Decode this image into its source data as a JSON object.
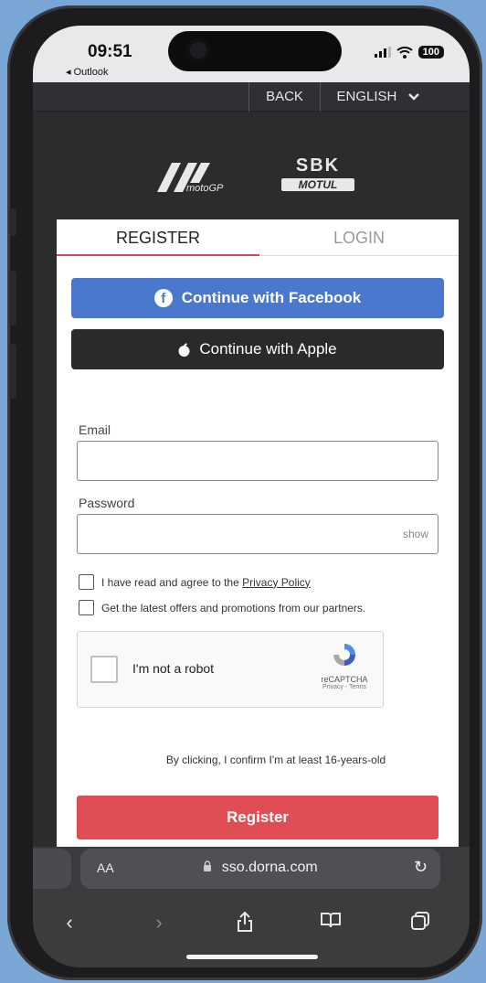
{
  "status_bar": {
    "time": "09:51",
    "back_app": "◂ Outlook",
    "battery": "100",
    "signal": "signal-icon",
    "wifi": "wifi-icon"
  },
  "top_bar": {
    "back": "BACK",
    "language": "ENGLISH"
  },
  "logos": {
    "motogp": "motoGP",
    "sbk_top": "SBK",
    "sbk_bottom": "MOTUL"
  },
  "tabs": {
    "register": "REGISTER",
    "login": "LOGIN"
  },
  "social": {
    "facebook": "Continue with Facebook",
    "apple": "Continue with Apple"
  },
  "form": {
    "email_label": "Email",
    "email_value": "",
    "password_label": "Password",
    "password_value": "",
    "show": "show",
    "privacy_prefix": "I have read and agree to the ",
    "privacy_link": "Privacy Policy",
    "offers": "Get the latest offers and promotions from our partners."
  },
  "captcha": {
    "label": "I'm not a robot",
    "brand": "reCAPTCHA",
    "links": "Privacy - Terms"
  },
  "confirm_text": "By clicking, I confirm I'm at least 16-years-old",
  "register_button": "Register",
  "safari": {
    "aa": "AA",
    "url": "sso.dorna.com"
  },
  "colors": {
    "accent_red": "#e14d55",
    "facebook_blue": "#4a78cf",
    "background": "#7aa6d6"
  }
}
